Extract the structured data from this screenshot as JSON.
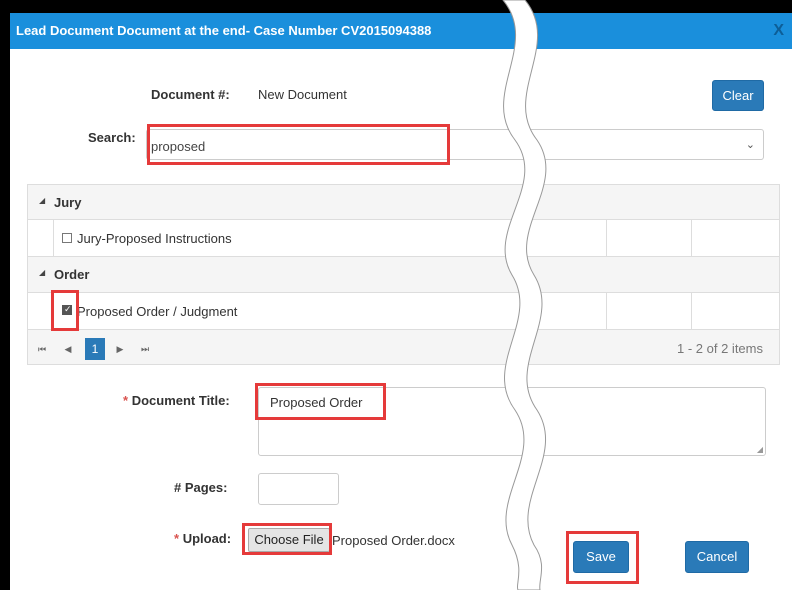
{
  "dialog": {
    "title": "Lead Document Document at the end- Case Number CV2015094388",
    "close_label": "X"
  },
  "form": {
    "document_label": "Document #:",
    "document_value": "New Document",
    "clear_label": "Clear",
    "search_label": "Search:",
    "search_value": "proposed",
    "doc_title_label": "Document Title:",
    "doc_title_value": "Proposed Order",
    "pages_label": "# Pages:",
    "pages_value": "",
    "upload_label": "Upload:",
    "choose_file_label": "Choose File",
    "file_name": "Proposed Order.docx",
    "required_mark": "*",
    "save_label": "Save",
    "cancel_label": "Cancel"
  },
  "grid": {
    "groups": [
      {
        "name": "Jury",
        "items": [
          {
            "label": "Jury-Proposed Instructions",
            "checked": false
          }
        ]
      },
      {
        "name": "Order",
        "items": [
          {
            "label": "Proposed Order / Judgment",
            "checked": true
          }
        ]
      }
    ],
    "pager": {
      "first": "⏮",
      "prev": "◀",
      "current_page": "1",
      "next": "▶",
      "last": "⏭",
      "info": "1 - 2 of 2 items"
    }
  },
  "colors": {
    "titlebar": "#1a8fdc",
    "button": "#2a7ab8",
    "highlight": "#e53a3a"
  }
}
